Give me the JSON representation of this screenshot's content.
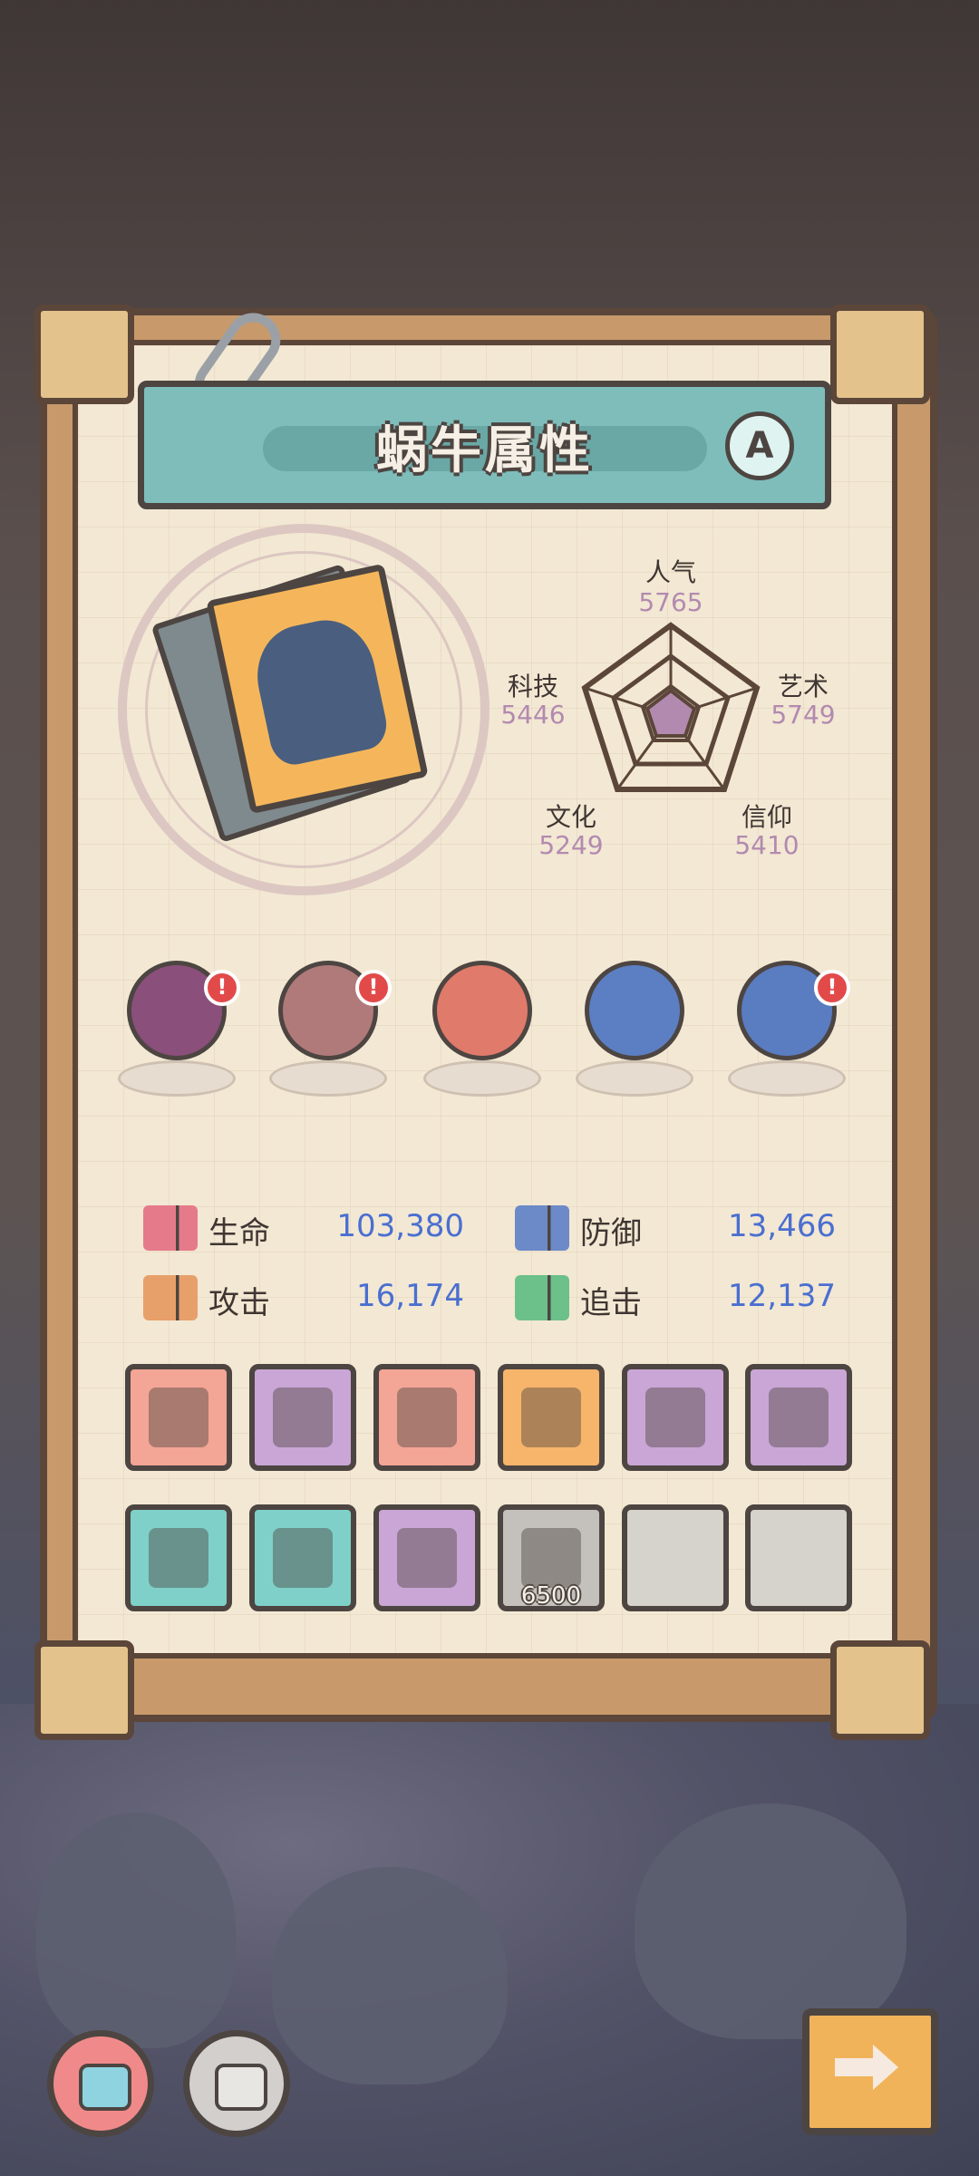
{
  "title": "蜗牛属性",
  "grade": "A",
  "attributes": [
    {
      "name": "人气",
      "value": "5765"
    },
    {
      "name": "艺术",
      "value": "5749"
    },
    {
      "name": "信仰",
      "value": "5410"
    },
    {
      "name": "文化",
      "value": "5249"
    },
    {
      "name": "科技",
      "value": "5446"
    }
  ],
  "equipment": [
    {
      "name": "tentacle-relic",
      "color": "#8a4f7a",
      "alert": "!"
    },
    {
      "name": "demon-mask-relic",
      "color": "#b07a7a",
      "alert": "!"
    },
    {
      "name": "snail-shell-relic",
      "color": "#e07a6a",
      "alert": ""
    },
    {
      "name": "compass-relic",
      "color": "#5b7fc2",
      "alert": ""
    },
    {
      "name": "gem-bowl-relic",
      "color": "#5a7cc0",
      "alert": "!"
    }
  ],
  "stats": [
    {
      "label": "生命",
      "value": "103,380",
      "color": "#e57b8a"
    },
    {
      "label": "防御",
      "value": "13,466",
      "color": "#6c8ac8"
    },
    {
      "label": "攻击",
      "value": "16,174",
      "color": "#e8a06a"
    },
    {
      "label": "追击",
      "value": "12,137",
      "color": "#6cc08a"
    }
  ],
  "items": [
    {
      "name": "belt-item",
      "color": "#f3a596",
      "count": ""
    },
    {
      "name": "wood-mask-item",
      "color": "#c9a6d6",
      "count": ""
    },
    {
      "name": "blaster-item",
      "color": "#f3a596",
      "count": ""
    },
    {
      "name": "katana-item",
      "color": "#f7b56b",
      "count": ""
    },
    {
      "name": "tribal-mask-item",
      "color": "#c9a6d6",
      "count": ""
    },
    {
      "name": "crossed-swords-item",
      "color": "#c9a6d6",
      "count": ""
    },
    {
      "name": "baton-item",
      "color": "#7fd0c8",
      "count": ""
    },
    {
      "name": "pickaxe-item",
      "color": "#7fd0c8",
      "count": ""
    },
    {
      "name": "drum-item",
      "color": "#c9a6d6",
      "count": ""
    },
    {
      "name": "scroll-item",
      "color": "#c4c0bc",
      "count": "6500"
    },
    {
      "name": "empty-slot",
      "color": "#d6d2cc",
      "count": ""
    },
    {
      "name": "empty-slot",
      "color": "#d6d2cc",
      "count": ""
    }
  ],
  "colors": {
    "accent": "#7fbdbb",
    "radar_fill": "#b28ab0",
    "value_blue": "#4a6fd1"
  }
}
